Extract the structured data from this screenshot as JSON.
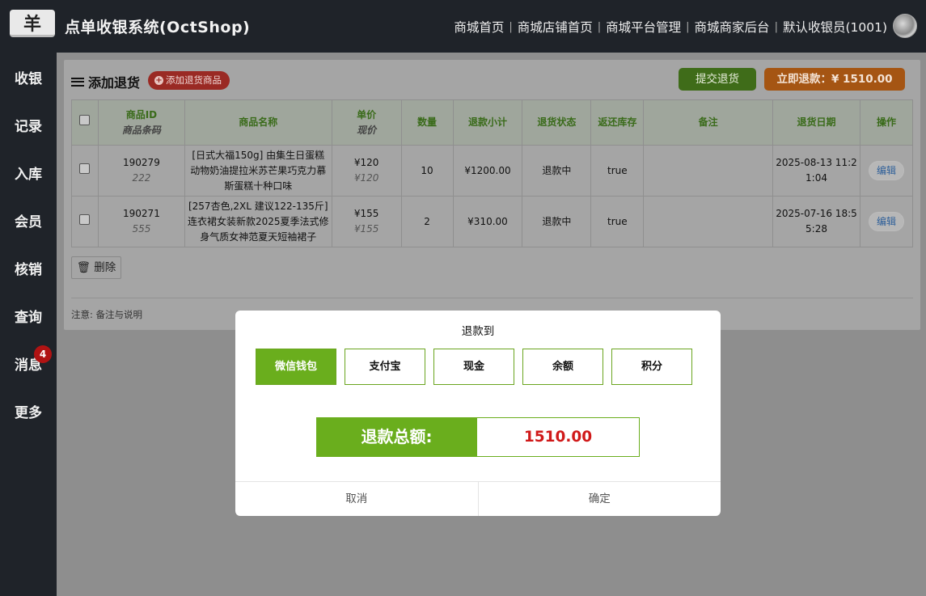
{
  "header": {
    "logo_glyph": "羊",
    "title": "点单收银系统(OctShop)",
    "nav": [
      "商城首页",
      "商城店铺首页",
      "商城平台管理",
      "商城商家后台",
      "默认收银员(1001)"
    ]
  },
  "sidebar": {
    "items": [
      "收银",
      "记录",
      "入库",
      "会员",
      "核销",
      "查询",
      "消息",
      "更多"
    ],
    "message_badge": "4"
  },
  "panel": {
    "title": "添加退货",
    "add_label": "添加退货商品",
    "submit_label": "提交退货",
    "refund_label": "立即退款：¥ 1510.00",
    "delete_label": "删除",
    "note": "注意: 备注与说明"
  },
  "table": {
    "headers": {
      "id": "商品ID",
      "barcode": "商品条码",
      "name": "商品名称",
      "unit_price": "单价",
      "current_price": "现价",
      "qty": "数量",
      "subtotal": "退款小计",
      "status": "退货状态",
      "restock": "返还库存",
      "remark": "备注",
      "date": "退货日期",
      "action": "操作"
    },
    "rows": [
      {
        "id": "190279",
        "barcode": "222",
        "name": "[日式大福150g] 由集生日蛋糕 动物奶油提拉米苏芒果巧克力慕斯蛋糕十种口味",
        "unit_price": "¥120",
        "current_price": "¥120",
        "qty": "10",
        "subtotal": "¥1200.00",
        "status": "退款中",
        "restock": "true",
        "remark": "",
        "date": "2025-08-13 11:21:04",
        "action": "编辑"
      },
      {
        "id": "190271",
        "barcode": "555",
        "name": "[257杏色,2XL 建议122-135斤] 连衣裙女装新款2025夏季法式修身气质女神范夏天短袖裙子",
        "unit_price": "¥155",
        "current_price": "¥155",
        "qty": "2",
        "subtotal": "¥310.00",
        "status": "退款中",
        "restock": "true",
        "remark": "",
        "date": "2025-07-16 18:55:28",
        "action": "编辑"
      }
    ]
  },
  "dialog": {
    "title": "退款到",
    "options": [
      "微信钱包",
      "支付宝",
      "现金",
      "余额",
      "积分"
    ],
    "selected": "微信钱包",
    "total_label": "退款总额:",
    "total_value": "1510.00",
    "cancel_label": "取消",
    "confirm_label": "确定"
  },
  "colors": {
    "accent_green": "#6aae1d",
    "refund_red": "#d01919",
    "refund_button": "#a55513"
  }
}
